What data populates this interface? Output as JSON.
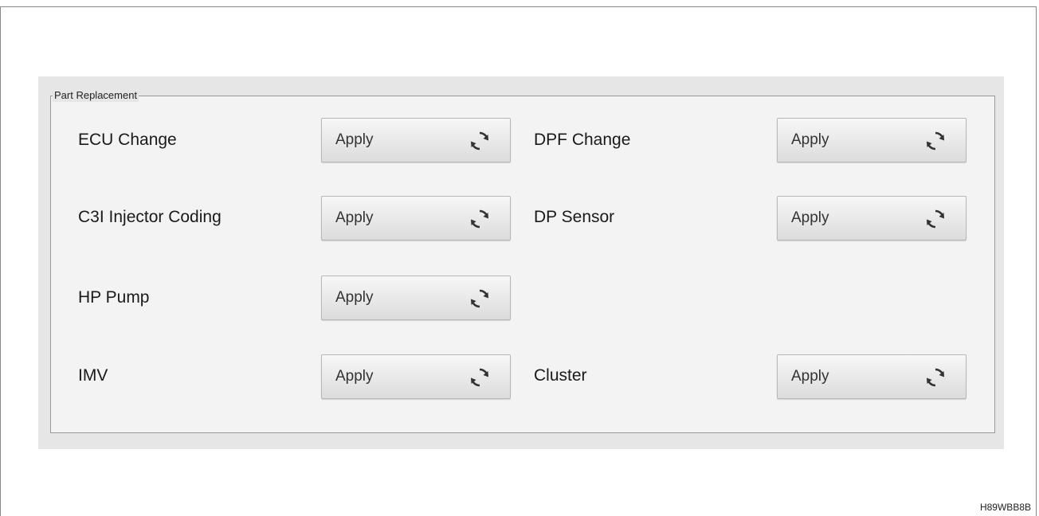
{
  "group": {
    "title": "Part Replacement"
  },
  "items": [
    {
      "label": "ECU Change",
      "button": "Apply"
    },
    {
      "label": "DPF Change",
      "button": "Apply"
    },
    {
      "label": "C3I Injector Coding",
      "button": "Apply"
    },
    {
      "label": "DP Sensor",
      "button": "Apply"
    },
    {
      "label": "HP Pump",
      "button": "Apply"
    },
    {
      "label": "IMV",
      "button": "Apply"
    },
    {
      "label": "Cluster",
      "button": "Apply"
    }
  ],
  "icon": "refresh-icon",
  "watermark": "H89WBB8B"
}
